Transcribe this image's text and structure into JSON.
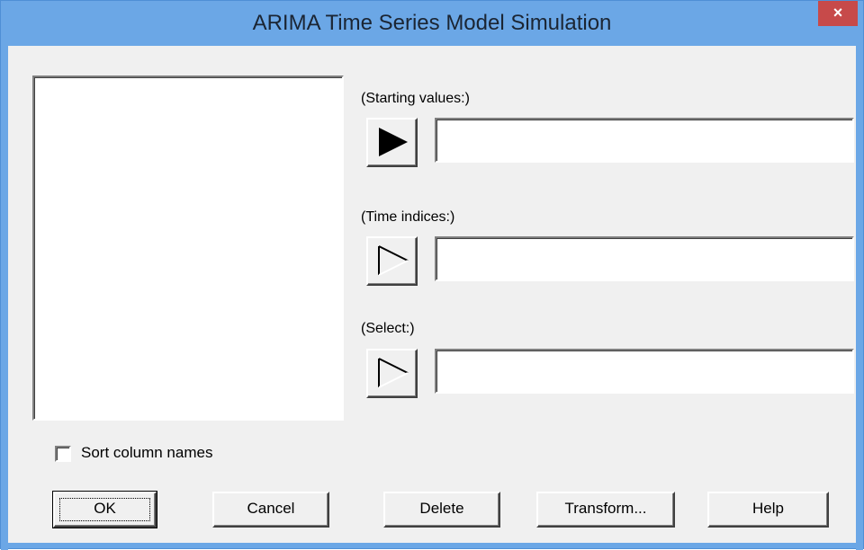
{
  "window": {
    "title": "ARIMA Time Series Model Simulation",
    "close_glyph": "×",
    "title_bar_color": "#6ba7e6",
    "close_color": "#c74a4a"
  },
  "fields": [
    {
      "label": "(Starting values:)",
      "value": "",
      "arrow_state": "filled"
    },
    {
      "label": "(Time indices:)",
      "value": "",
      "arrow_state": "outline"
    },
    {
      "label": "(Select:)",
      "value": "",
      "arrow_state": "outline"
    }
  ],
  "checkbox": {
    "label": "Sort column names",
    "checked": false
  },
  "buttons": {
    "ok": "OK",
    "cancel": "Cancel",
    "delete": "Delete",
    "transform": "Transform...",
    "help": "Help"
  },
  "icons": {
    "close": "close-icon",
    "arrow_filled": "play-arrow-icon",
    "arrow_outline": "play-arrow-outline-icon"
  }
}
